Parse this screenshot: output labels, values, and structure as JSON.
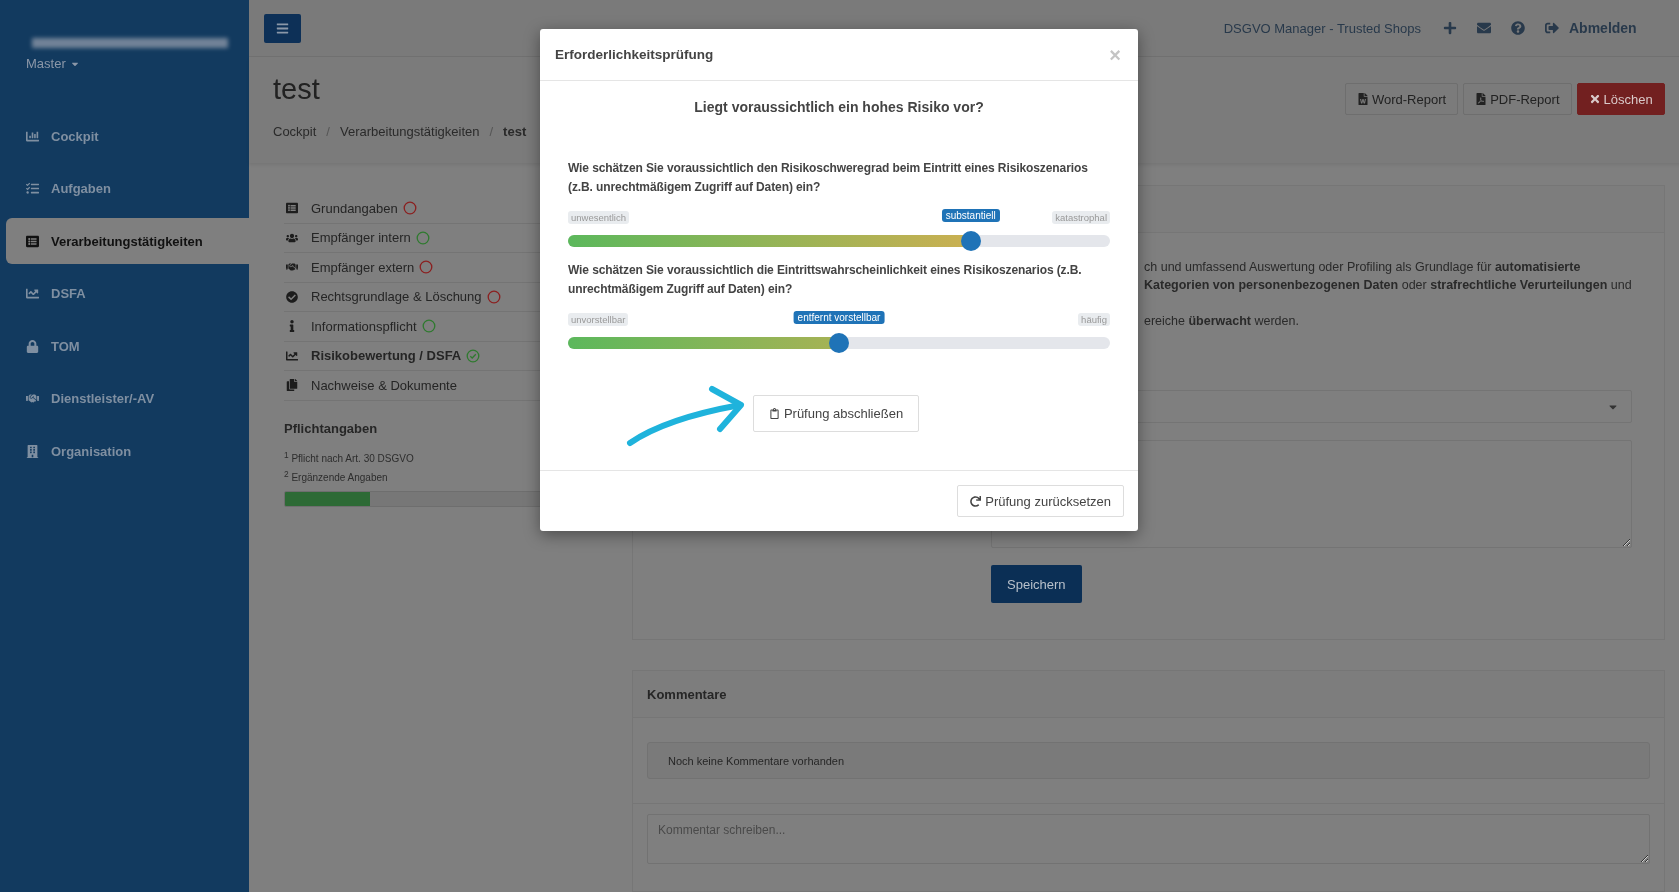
{
  "sidebar": {
    "account": "Master",
    "items": [
      {
        "label": "Cockpit",
        "selected": false
      },
      {
        "label": "Aufgaben",
        "selected": false
      },
      {
        "label": "Verarbeitungstätigkeiten",
        "selected": true
      },
      {
        "label": "DSFA",
        "selected": false
      },
      {
        "label": "TOM",
        "selected": false
      },
      {
        "label": "Dienstleister/-AV",
        "selected": false
      },
      {
        "label": "Organisation",
        "selected": false
      }
    ]
  },
  "topbar": {
    "app_name": "DSGVO Manager - Trusted Shops",
    "logout": "Abmelden"
  },
  "header": {
    "title": "test",
    "breadcrumb_separator": "/",
    "breadcrumb": [
      {
        "label": "Cockpit",
        "current": false
      },
      {
        "label": "Verarbeitungstätigkeiten",
        "current": false
      },
      {
        "label": "test",
        "current": true
      }
    ],
    "actions": [
      {
        "label": "Word-Report",
        "kind": "word"
      },
      {
        "label": "PDF-Report",
        "kind": "pdf"
      },
      {
        "label": "Löschen",
        "kind": "delete"
      }
    ]
  },
  "nav": {
    "items": [
      {
        "label": "Grundangaben",
        "selected": false,
        "complete": false,
        "verified": false
      },
      {
        "label": "Empfänger intern",
        "selected": false,
        "complete": true,
        "verified": false
      },
      {
        "label": "Empfänger extern",
        "selected": false,
        "complete": false,
        "verified": false
      },
      {
        "label": "Rechtsgrundlage & Löschung",
        "selected": false,
        "complete": false,
        "verified": false
      },
      {
        "label": "Informationspflicht",
        "selected": false,
        "complete": true,
        "verified": false
      },
      {
        "label": "Risikobewertung / DSFA",
        "selected": true,
        "complete": true,
        "verified": true
      },
      {
        "label": "Nachweise & Dokumente",
        "selected": false
      }
    ],
    "legend_title": "Pflichtangaben",
    "legend": [
      "$^{1}$ Pflicht nach Art. 30 DSGVO",
      "$^{2}$ Ergänzende Angaben"
    ],
    "progress": {
      "level": 0.28
    }
  },
  "content": {
    "lines": [
      "ch und umfassend Auswertung oder Profiling als Grundlage für **automatisierte**",
      "**Kategorien von personenbezogenen Daten** oder **strafrechtliche Verurteilungen** und",
      "ereiche **überwacht** werden."
    ],
    "save": "Speichern"
  },
  "comments": {
    "title": "Kommentare",
    "empty": "Noch keine Kommentare vorhanden",
    "placeholder": "Kommentar schreiben..."
  },
  "modal": {
    "title": "Erforderlichkeitsprüfung",
    "close": "×",
    "question": "Liegt voraussichtlich ein hohes Risiko vor?",
    "sliders": [
      {
        "question": "Wie schätzen Sie voraussichtlich den Risikoschweregrad beim Eintritt eines Risikoszenarios (z.B. unrechtmäßigem Zugriff auf Daten) ein?",
        "min_label": "unwesentlich",
        "max_label": "katastrophal",
        "value_label": "substantiell",
        "level": 0.743
      },
      {
        "question": "Wie schätzen Sie voraussichtlich die Eintrittswahrscheinlichkeit eines Risikoszenarios (z.B. unrechtmäßigem Zugriff auf Daten) ein?",
        "min_label": "unvorstellbar",
        "max_label": "häufig",
        "value_label": "entfernt vorstellbar",
        "level": 0.5
      }
    ],
    "finish": "Prüfung abschließen",
    "reset": "Prüfung zurücksetzen"
  }
}
